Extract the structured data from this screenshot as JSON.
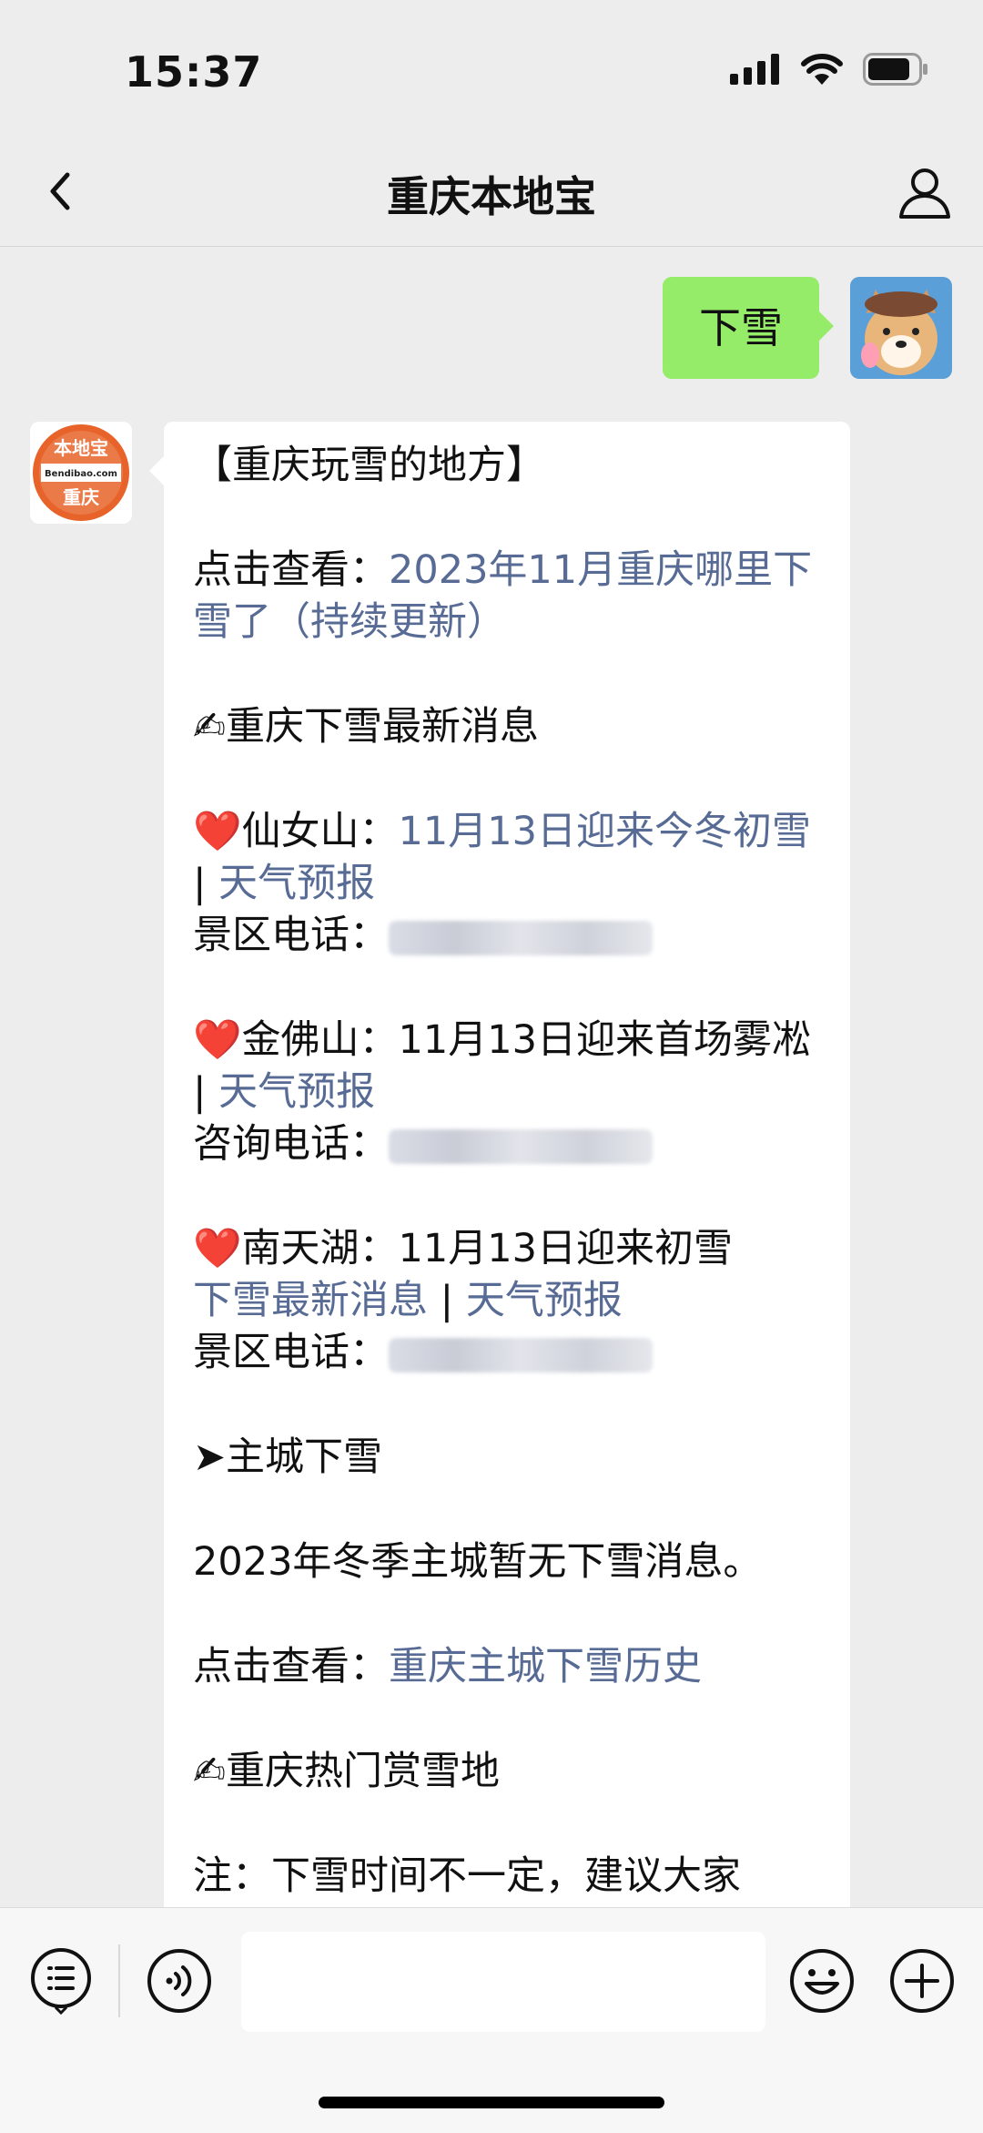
{
  "status": {
    "time": "15:37"
  },
  "nav": {
    "title": "重庆本地宝"
  },
  "sent": {
    "text": "下雪"
  },
  "bot_logo": {
    "top": "本地宝",
    "middle": "Bendibao.com",
    "bottom": "重庆"
  },
  "message": {
    "heading": "【重庆玩雪的地方】",
    "view_prefix_1": "点击查看：",
    "view_link_1": "2023年11月重庆哪里下雪了（持续更新）",
    "section_1": "✍重庆下雪最新消息",
    "items": [
      {
        "name": "仙女山：",
        "desc": "",
        "link_1": "11月13日迎来今冬初雪",
        "link_2": "天气预报",
        "phone_label": "景区电话："
      },
      {
        "name": "金佛山：",
        "desc": "11月13日迎来首场雾凇",
        "link_1": "",
        "link_2": "天气预报",
        "phone_label": "咨询电话："
      },
      {
        "name": "南天湖：",
        "desc": "11月13日迎来初雪",
        "link_1": "下雪最新消息",
        "link_2": "天气预报",
        "phone_label": "景区电话："
      }
    ],
    "separator": " | ",
    "heart": "❤️",
    "section_2": "➤主城下雪",
    "main_city_note": "2023年冬季主城暂无下雪消息。",
    "view_prefix_2": "点击查看：",
    "view_link_2": "重庆主城下雪历史",
    "section_3": "✍重庆热门赏雪地",
    "note": "注：下雪时间不一定，建议大家"
  },
  "colors": {
    "link": "#576b95",
    "sent_bubble": "#95ec69",
    "logo_orange": "#e8632a"
  }
}
